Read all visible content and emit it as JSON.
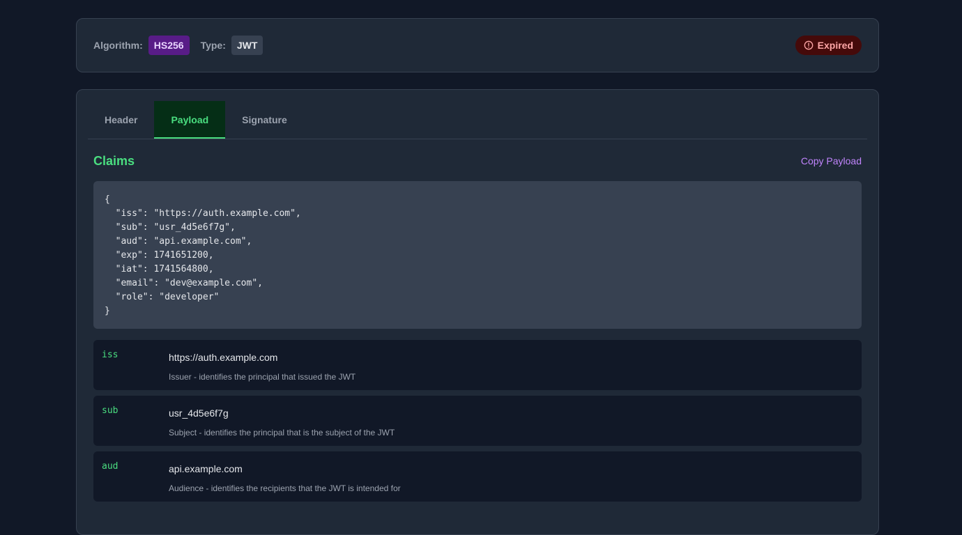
{
  "meta": {
    "algorithm_label": "Algorithm:",
    "algorithm_value": "HS256",
    "type_label": "Type:",
    "type_value": "JWT",
    "status": "Expired"
  },
  "tabs": [
    {
      "label": "Header",
      "active": false
    },
    {
      "label": "Payload",
      "active": true
    },
    {
      "label": "Signature",
      "active": false
    }
  ],
  "claims": {
    "title": "Claims",
    "copy_label": "Copy Payload",
    "json": "{\n  \"iss\": \"https://auth.example.com\",\n  \"sub\": \"usr_4d5e6f7g\",\n  \"aud\": \"api.example.com\",\n  \"exp\": 1741651200,\n  \"iat\": 1741564800,\n  \"email\": \"dev@example.com\",\n  \"role\": \"developer\"\n}",
    "rows": [
      {
        "key": "iss",
        "value": "https://auth.example.com",
        "desc": "Issuer - identifies the principal that issued the JWT"
      },
      {
        "key": "sub",
        "value": "usr_4d5e6f7g",
        "desc": "Subject - identifies the principal that is the subject of the JWT"
      },
      {
        "key": "aud",
        "value": "api.example.com",
        "desc": "Audience - identifies the recipients that the JWT is intended for"
      }
    ]
  },
  "colors": {
    "accent": "#4ade80",
    "link": "#c084fc",
    "expired": "#fca5a5"
  },
  "icons": {
    "status_icon": "alert-circle-icon"
  }
}
